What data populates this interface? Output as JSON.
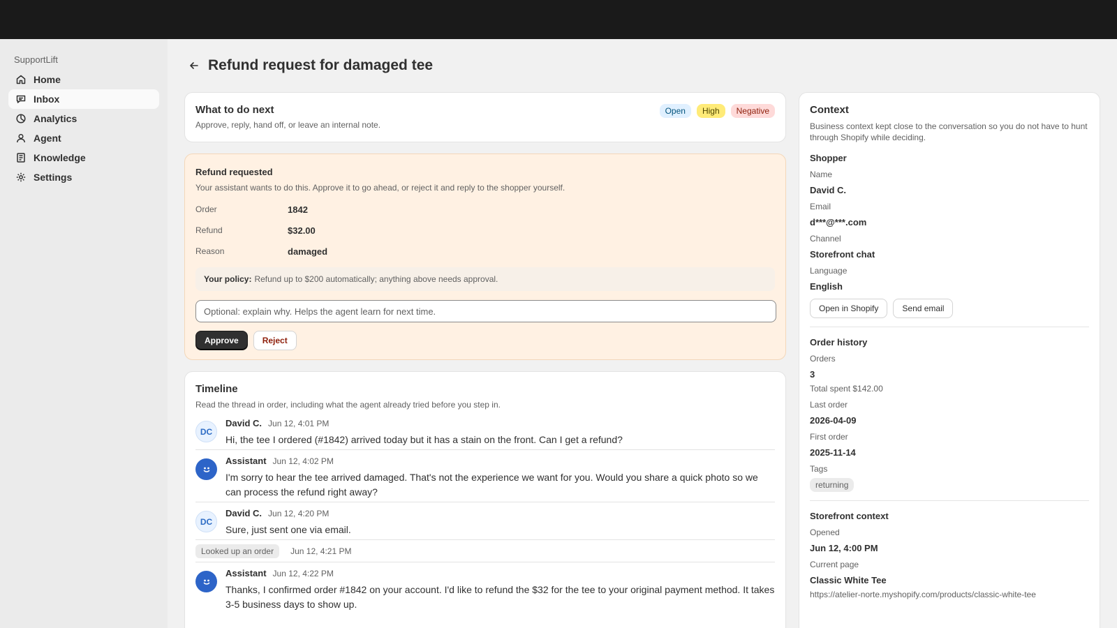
{
  "sidebar": {
    "brand": "SupportLift",
    "items": [
      {
        "label": "Home",
        "icon": "home-icon"
      },
      {
        "label": "Inbox",
        "icon": "inbox-icon",
        "active": true
      },
      {
        "label": "Analytics",
        "icon": "analytics-icon"
      },
      {
        "label": "Agent",
        "icon": "agent-icon"
      },
      {
        "label": "Knowledge",
        "icon": "knowledge-icon"
      },
      {
        "label": "Settings",
        "icon": "gear-icon"
      }
    ]
  },
  "header": {
    "title": "Refund request for damaged tee"
  },
  "next": {
    "title": "What to do next",
    "subtitle": "Approve, reply, hand off, or leave an internal note.",
    "badges": {
      "status": "Open",
      "priority": "High",
      "sentiment": "Negative"
    }
  },
  "refund": {
    "title": "Refund requested",
    "subtitle": "Your assistant wants to do this. Approve it to go ahead, or reject it and reply to the shopper yourself.",
    "rows": [
      {
        "label": "Order",
        "value": "1842"
      },
      {
        "label": "Refund",
        "value": "$32.00"
      },
      {
        "label": "Reason",
        "value": "damaged"
      }
    ],
    "policy_label": "Your policy:",
    "policy_text": "Refund up to $200 automatically; anything above needs approval.",
    "note_placeholder": "Optional: explain why. Helps the agent learn for next time.",
    "approve_label": "Approve",
    "reject_label": "Reject"
  },
  "timeline": {
    "title": "Timeline",
    "subtitle": "Read the thread in order, including what the agent already tried before you step in.",
    "entries": [
      {
        "author": "David C.",
        "initials": "DC",
        "time": "Jun 12, 4:01 PM",
        "text": "Hi, the tee I ordered (#1842) arrived today but it has a stain on the front. Can I get a refund?"
      },
      {
        "author": "Assistant",
        "time": "Jun 12, 4:02 PM",
        "text": "I'm sorry to hear the tee arrived damaged. That's not the experience we want for you. Would you share a quick photo so we can process the refund right away?"
      },
      {
        "author": "David C.",
        "initials": "DC",
        "time": "Jun 12, 4:20 PM",
        "text": "Sure, just sent one via email."
      },
      {
        "event": "Looked up an order",
        "time": "Jun 12, 4:21 PM"
      },
      {
        "author": "Assistant",
        "time": "Jun 12, 4:22 PM",
        "text": "Thanks, I confirmed order #1842 on your account. I'd like to refund the $32 for the tee to your original payment method. It takes 3-5 business days to show up."
      }
    ]
  },
  "context": {
    "title": "Context",
    "subtitle": "Business context kept close to the conversation so you do not have to hunt through Shopify while deciding.",
    "shopper": {
      "title": "Shopper",
      "name_label": "Name",
      "name": "David C.",
      "email_label": "Email",
      "email": "d***@***.com",
      "channel_label": "Channel",
      "channel": "Storefront chat",
      "language_label": "Language",
      "language": "English",
      "open_shopify_label": "Open in Shopify",
      "send_email_label": "Send email"
    },
    "orders": {
      "title": "Order history",
      "orders_label": "Orders",
      "orders": "3",
      "total_spent": "Total spent $142.00",
      "last_label": "Last order",
      "last": "2026-04-09",
      "first_label": "First order",
      "first": "2025-11-14",
      "tags_label": "Tags",
      "tag": "returning"
    },
    "storefront": {
      "title": "Storefront context",
      "opened_label": "Opened",
      "opened": "Jun 12, 4:00 PM",
      "page_label": "Current page",
      "page": "Classic White Tee",
      "url": "https://atelier-norte.myshopify.com/products/classic-white-tee"
    }
  }
}
